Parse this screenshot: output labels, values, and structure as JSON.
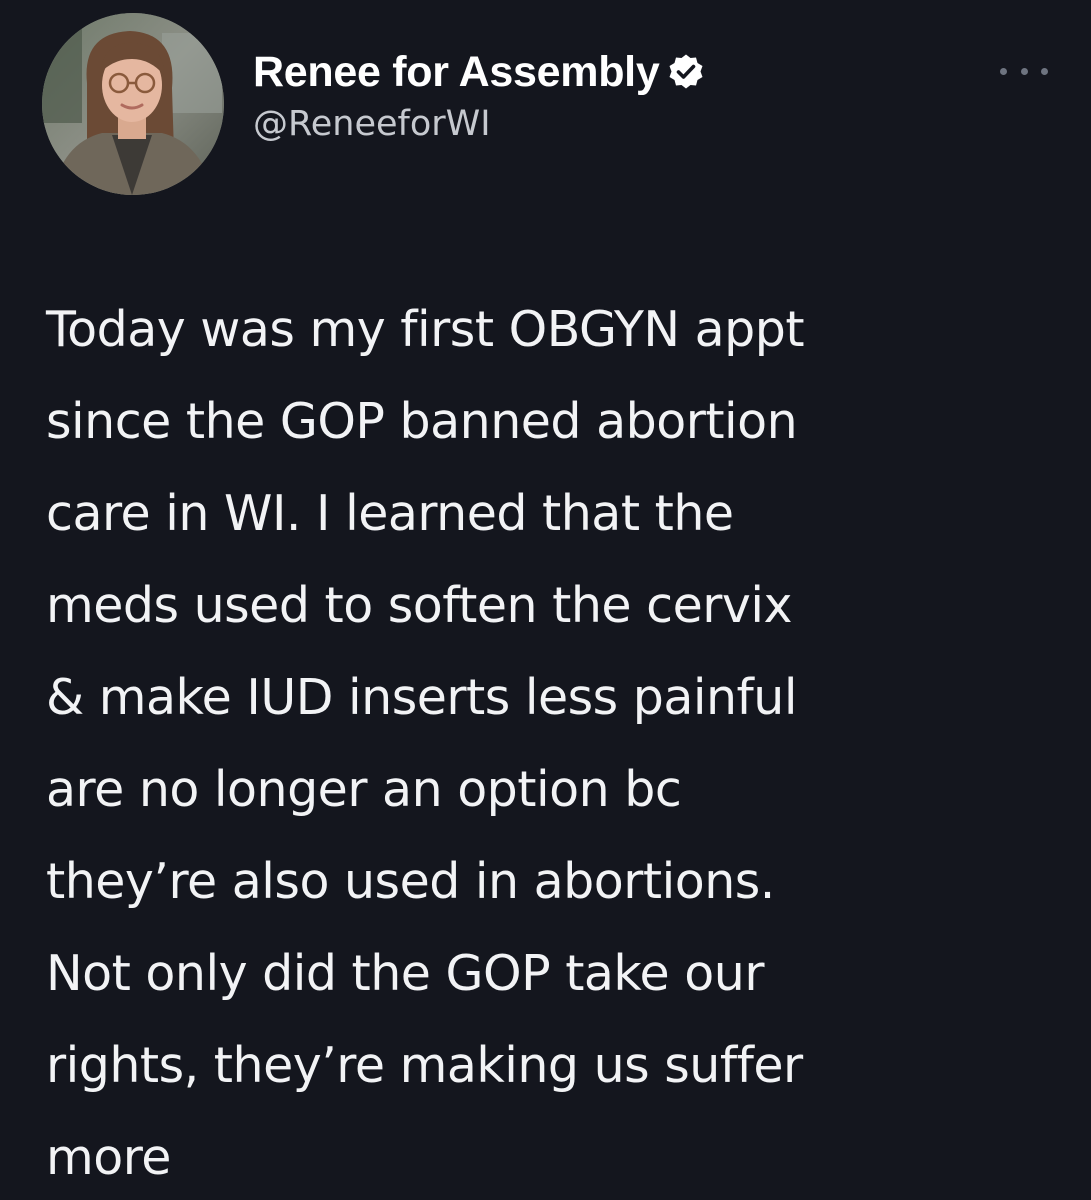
{
  "author": {
    "display_name": "Renee for Assembly",
    "handle": "@ReneeforWI",
    "avatar_icon": "profile-photo",
    "verified_icon": "verified-badge-icon"
  },
  "actions": {
    "more_icon": "more-options-icon"
  },
  "tweet": {
    "lines": [
      "Today was my first OBGYN appt",
      "since the GOP banned abortion",
      "care in WI. I learned that the",
      "meds used to soften the cervix",
      "& make IUD inserts less painful",
      "are no longer an option bc",
      "they’re also used in abortions.",
      "Not only did the GOP take our",
      "rights, they’re making us suffer",
      "more"
    ]
  },
  "colors": {
    "background": "#14161e",
    "text": "#f2f3f5",
    "handle": "#c6c9cf",
    "more_dots": "#6e7480"
  }
}
